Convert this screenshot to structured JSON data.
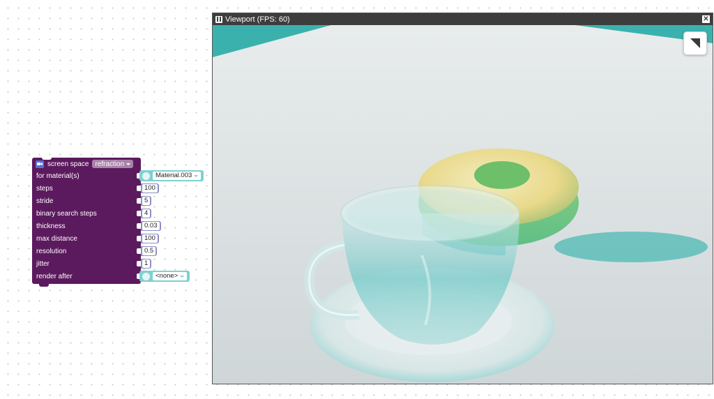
{
  "block": {
    "title": "screen space",
    "mode": "refraction",
    "rows": [
      {
        "label": "for material(s)"
      },
      {
        "label": "steps",
        "value": "100"
      },
      {
        "label": "stride",
        "value": "5"
      },
      {
        "label": "binary search steps",
        "value": "4"
      },
      {
        "label": "thickness",
        "value": "0.03"
      },
      {
        "label": "max distance",
        "value": "100"
      },
      {
        "label": "resolution",
        "value": "0.5"
      },
      {
        "label": "jitter",
        "value": "1"
      },
      {
        "label": "render after"
      }
    ],
    "material": "Material.003",
    "render_after": "<none>",
    "colors": {
      "block": "#5c1a5e",
      "number": "#8c8fc7",
      "object": "#7fd0cf",
      "icon": "#5b6fd8"
    }
  },
  "viewport": {
    "title": "Viewport (FPS: 60)",
    "close_label": "✕"
  }
}
